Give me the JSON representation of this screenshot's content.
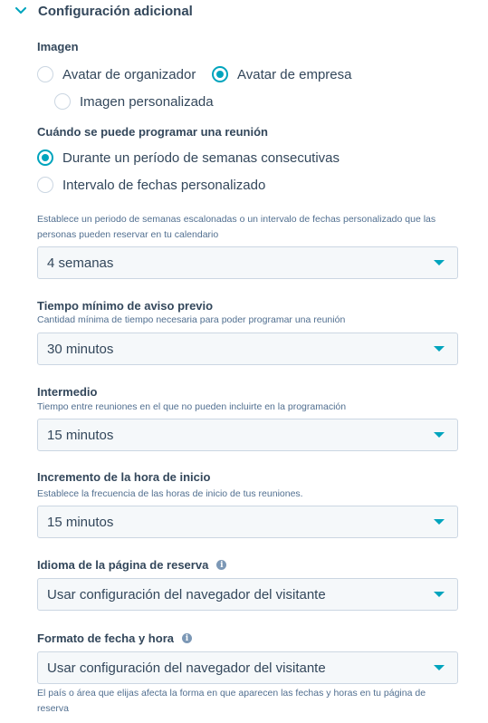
{
  "section": {
    "title": "Configuración adicional",
    "icon": "chevron-down-icon"
  },
  "image": {
    "label": "Imagen",
    "options": [
      {
        "label": "Avatar de organizador",
        "checked": false
      },
      {
        "label": "Avatar de empresa",
        "checked": true
      },
      {
        "label": "Imagen personalizada",
        "checked": false
      }
    ]
  },
  "when": {
    "label": "Cuándo se puede programar una reunión",
    "options": [
      {
        "label": "Durante un período de semanas consecutivas",
        "checked": true
      },
      {
        "label": "Intervalo de fechas personalizado",
        "checked": false
      }
    ],
    "help_line1": "Establece un periodo de semanas escalonadas o un intervalo de fechas personalizado que las",
    "help_line2": "personas pueden reservar en tu calendario",
    "value": "4 semanas"
  },
  "notice": {
    "label": "Tiempo mínimo de aviso previo",
    "help": "Cantidad mínima de tiempo necesaria para poder programar una reunión",
    "value": "30 minutos"
  },
  "buffer": {
    "label": "Intermedio",
    "help": "Tiempo entre reuniones en el que no pueden incluirte en la programación",
    "value": "15 minutos"
  },
  "increment": {
    "label": "Incremento de la hora de inicio",
    "help": "Establece la frecuencia de las horas de inicio de tus reuniones.",
    "value": "15 minutos"
  },
  "language": {
    "label": "Idioma de la página de reserva",
    "value": "Usar configuración del navegador del visitante"
  },
  "format": {
    "label": "Formato de fecha y hora",
    "value": "Usar configuración del navegador del visitante",
    "help_line1": "El país o área que elijas afecta la forma en que aparecen las fechas y horas en tu página de",
    "help_line2": "reserva"
  },
  "colors": {
    "accent": "#00a4bd",
    "text": "#33475b",
    "muted": "#516f90",
    "border": "#cbd6e2",
    "field_bg": "#f5f8fa"
  }
}
